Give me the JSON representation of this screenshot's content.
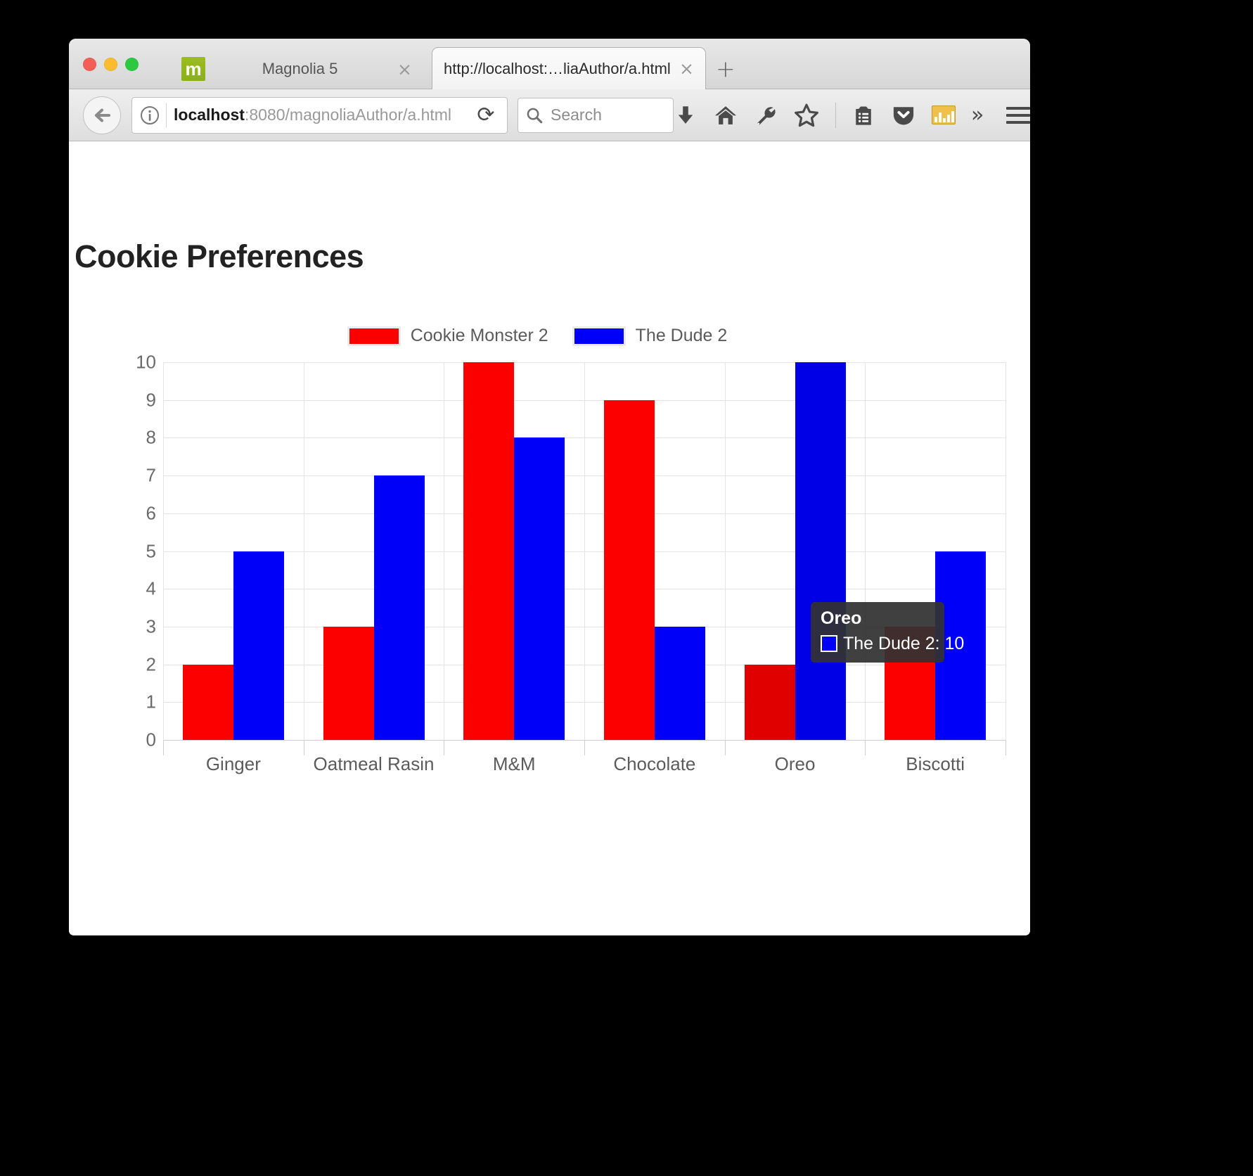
{
  "window": {
    "traffic_lights": [
      "close",
      "minimize",
      "zoom"
    ],
    "new_tab_label": "+"
  },
  "tabs": [
    {
      "favicon_letter": "m",
      "title": "Magnolia 5",
      "close_label": "×",
      "active": false
    },
    {
      "title": "http://localhost:…liaAuthor/a.html",
      "close_label": "×",
      "active": true
    }
  ],
  "toolbar": {
    "back_label": "←",
    "url_prefix": "localhost",
    "url_suffix": ":8080/magnoliaAuthor/a.html",
    "url_full": "localhost:8080/magnoliaAuthor/a.html",
    "reload_label": "⟳",
    "search_placeholder": "Search",
    "icons": [
      "download-icon",
      "home-icon",
      "wrench-icon",
      "star-icon",
      "reader-icon",
      "pocket-icon",
      "chart-icon",
      "overflow-chevron-icon",
      "hamburger-menu-icon"
    ],
    "overflow_label": "»"
  },
  "page": {
    "title": "Cookie Preferences"
  },
  "chart_data": {
    "type": "bar",
    "title": "Cookie Preferences",
    "xlabel": "",
    "ylabel": "",
    "ylim": [
      0,
      10
    ],
    "y_ticks": [
      "10",
      "9",
      "8",
      "7",
      "6",
      "5",
      "4",
      "3",
      "2",
      "1",
      "0"
    ],
    "grid": true,
    "legend_position": "top-center",
    "categories": [
      "Ginger",
      "Oatmeal Rasin",
      "M&M",
      "Chocolate",
      "Oreo",
      "Biscotti"
    ],
    "series": [
      {
        "name": "Cookie Monster 2",
        "color": "#fc0000",
        "values": [
          2,
          3,
          10,
          9,
          2,
          3
        ]
      },
      {
        "name": "The Dude 2",
        "color": "#0000fa",
        "values": [
          5,
          7,
          8,
          3,
          10,
          5
        ]
      }
    ]
  },
  "tooltip": {
    "title": "Oreo",
    "series_name": "The Dude 2",
    "value": "10",
    "text": "The Dude 2: 10",
    "swatch_color": "#0000fa",
    "hovered_category": "Oreo",
    "hovered_series": "The Dude 2"
  },
  "colors": {
    "series_red": "#fc0000",
    "series_blue": "#0000fa",
    "grid": "#e4e4e4",
    "axis_text": "#5b5b5b",
    "tooltip_bg": "#323232"
  }
}
